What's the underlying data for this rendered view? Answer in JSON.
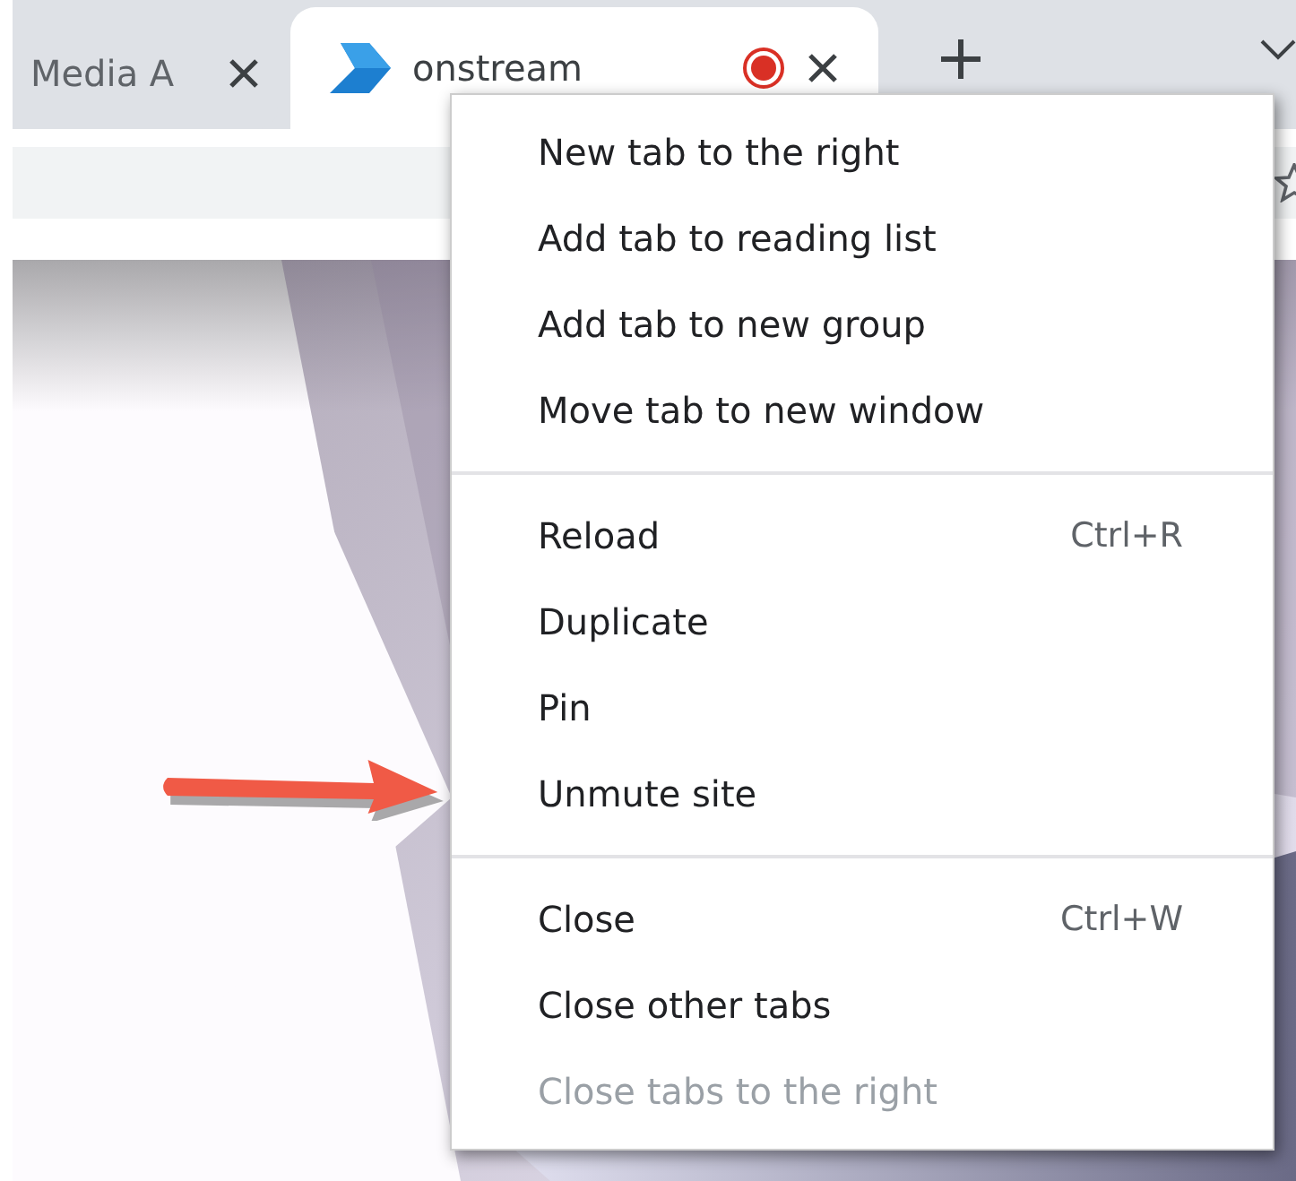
{
  "tabs": [
    {
      "title": "Media A",
      "selected": false,
      "recording": false
    },
    {
      "title": "onstream",
      "selected": true,
      "recording": true
    }
  ],
  "context_menu": {
    "sections": [
      [
        {
          "label": "New tab to the right",
          "disabled": false
        },
        {
          "label": "Add tab to reading list",
          "disabled": false
        },
        {
          "label": "Add tab to new group",
          "disabled": false
        },
        {
          "label": "Move tab to new window",
          "disabled": false
        }
      ],
      [
        {
          "label": "Reload",
          "shortcut": "Ctrl+R",
          "disabled": false
        },
        {
          "label": "Duplicate",
          "disabled": false
        },
        {
          "label": "Pin",
          "disabled": false
        },
        {
          "label": "Unmute site",
          "disabled": false
        }
      ],
      [
        {
          "label": "Close",
          "shortcut": "Ctrl+W",
          "disabled": false
        },
        {
          "label": "Close other tabs",
          "disabled": false
        },
        {
          "label": "Close tabs to the right",
          "disabled": true
        }
      ]
    ]
  }
}
